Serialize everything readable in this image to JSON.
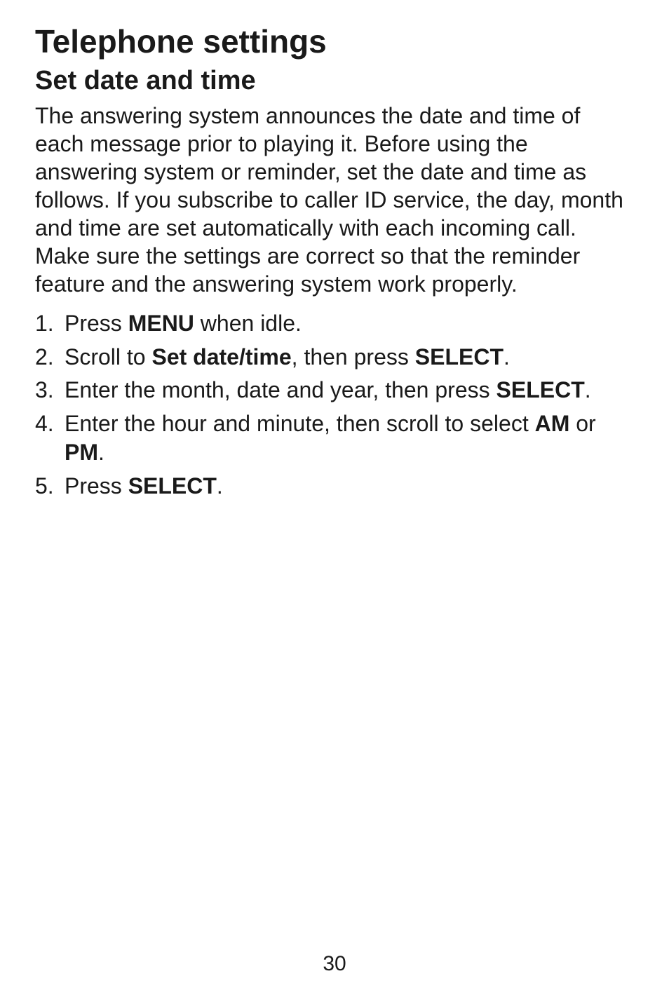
{
  "title": "Telephone settings",
  "section_title": "Set date and time",
  "intro": "The answering system announces the date and time of each message prior to playing it. Before using the answering system or reminder, set the date and time as follows. If you subscribe to caller ID service, the day, month and time are set automatically with each incoming call. Make sure the settings are correct so that the reminder feature and the answering system work properly.",
  "steps": {
    "s1": {
      "t1": "Press ",
      "b1": "MENU",
      "t2": " when idle."
    },
    "s2": {
      "t1": "Scroll to ",
      "b1": "Set date/time",
      "t2": ", then press ",
      "b2": "SELECT",
      "t3": "."
    },
    "s3": {
      "t1": "Enter the month, date and year, then press ",
      "b1": "SELECT",
      "t2": "."
    },
    "s4": {
      "t1": "Enter the hour and minute, then scroll to select ",
      "b1": "AM",
      "t2": " or ",
      "b2": "PM",
      "t3": "."
    },
    "s5": {
      "t1": "Press ",
      "b1": "SELECT",
      "t2": "."
    }
  },
  "page_number": "30"
}
